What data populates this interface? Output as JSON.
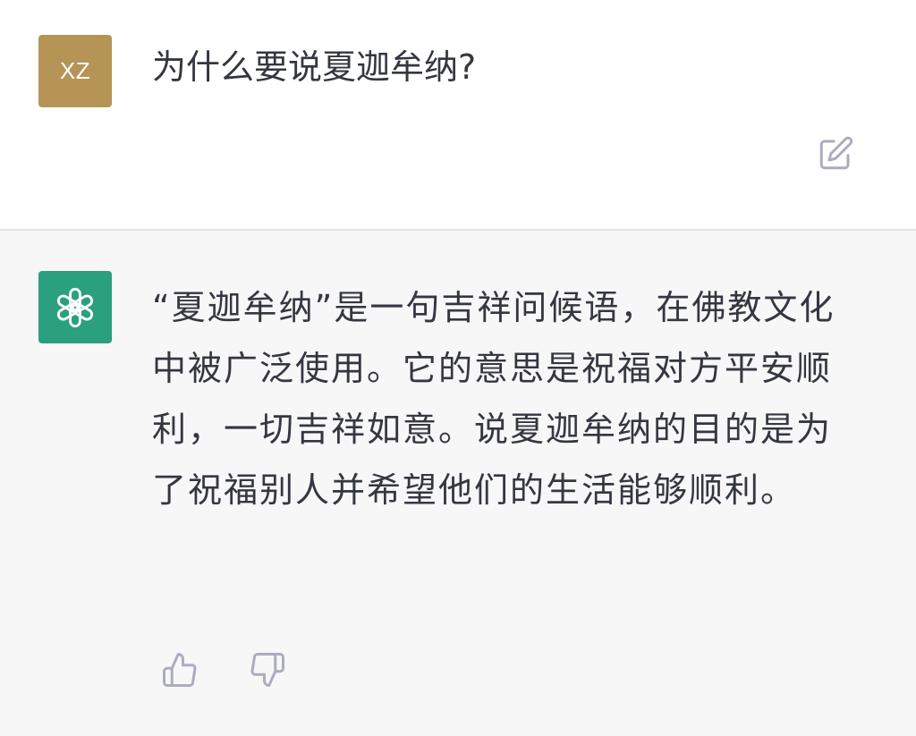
{
  "user_message": {
    "avatar_initials": "XZ",
    "avatar_color": "#b59455",
    "text": "为什么要说夏迦牟纳?",
    "edit_icon": "edit-icon"
  },
  "assistant_message": {
    "avatar_icon": "openai-logo-icon",
    "avatar_color": "#2aa07e",
    "text": "“夏迦牟纳”是一句吉祥问候语，在佛教文化中被广泛使用。它的意思是祝福对方平安顺利，一切吉祥如意。说夏迦牟纳的目的是为了祝福别人并希望他们的生活能够顺利。",
    "feedback_icons": [
      "thumbs-up-icon",
      "thumbs-down-icon"
    ]
  },
  "colors": {
    "text": "#353740",
    "assistant_background": "#f7f7f8",
    "icon_gray": "#acacbe"
  }
}
